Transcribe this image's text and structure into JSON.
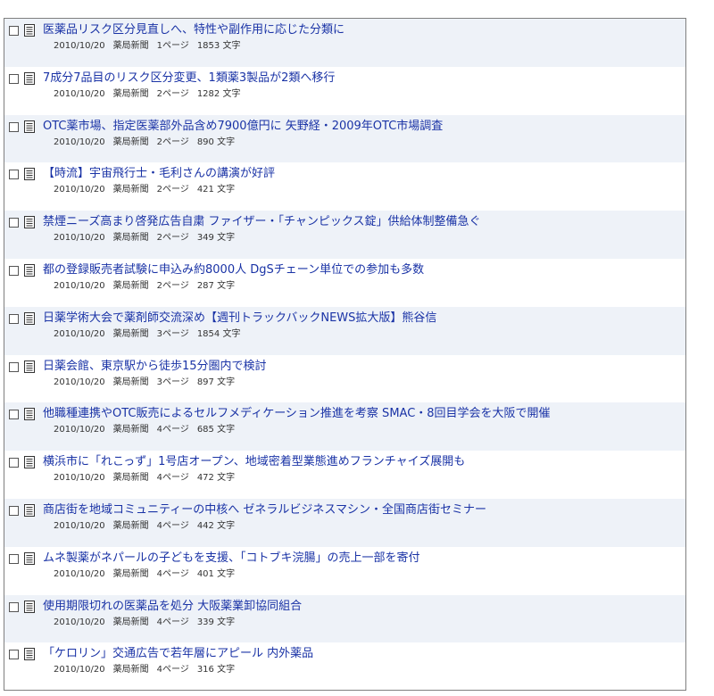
{
  "articles": [
    {
      "title": "医薬品リスク区分見直しへ、特性や副作用に応じた分類に",
      "date": "2010/10/20",
      "source": "薬局新聞",
      "page": "1ページ",
      "chars": "1853 文字"
    },
    {
      "title": "7成分7品目のリスク区分変更、1類薬3製品が2類へ移行",
      "date": "2010/10/20",
      "source": "薬局新聞",
      "page": "2ページ",
      "chars": "1282 文字"
    },
    {
      "title": "OTC薬市場、指定医薬部外品含め7900億円に 矢野経・2009年OTC市場調査",
      "date": "2010/10/20",
      "source": "薬局新聞",
      "page": "2ページ",
      "chars": "890 文字"
    },
    {
      "title": "【時流】宇宙飛行士・毛利さんの講演が好評",
      "date": "2010/10/20",
      "source": "薬局新聞",
      "page": "2ページ",
      "chars": "421 文字"
    },
    {
      "title": "禁煙ニーズ高まり啓発広告自粛 ファイザー・「チャンピックス錠」供給体制整備急ぐ",
      "date": "2010/10/20",
      "source": "薬局新聞",
      "page": "2ページ",
      "chars": "349 文字"
    },
    {
      "title": "都の登録販売者試験に申込み約8000人 DgSチェーン単位での参加も多数",
      "date": "2010/10/20",
      "source": "薬局新聞",
      "page": "2ページ",
      "chars": "287 文字"
    },
    {
      "title": "日薬学術大会で薬剤師交流深め【週刊トラックバックNEWS拡大版】熊谷信",
      "date": "2010/10/20",
      "source": "薬局新聞",
      "page": "3ページ",
      "chars": "1854 文字"
    },
    {
      "title": "日薬会館、東京駅から徒歩15分圏内で検討",
      "date": "2010/10/20",
      "source": "薬局新聞",
      "page": "3ページ",
      "chars": "897 文字"
    },
    {
      "title": "他職種連携やOTC販売によるセルフメディケーション推進を考察 SMAC・8回目学会を大阪で開催",
      "date": "2010/10/20",
      "source": "薬局新聞",
      "page": "4ページ",
      "chars": "685 文字"
    },
    {
      "title": "横浜市に「れこっず」1号店オープン、地域密着型業態進めフランチャイズ展開も",
      "date": "2010/10/20",
      "source": "薬局新聞",
      "page": "4ページ",
      "chars": "472 文字"
    },
    {
      "title": "商店街を地域コミュニティーの中核へ ゼネラルビジネスマシン・全国商店街セミナー",
      "date": "2010/10/20",
      "source": "薬局新聞",
      "page": "4ページ",
      "chars": "442 文字"
    },
    {
      "title": "ムネ製薬がネパールの子どもを支援、「コトブキ浣腸」の売上一部を寄付",
      "date": "2010/10/20",
      "source": "薬局新聞",
      "page": "4ページ",
      "chars": "401 文字"
    },
    {
      "title": "使用期限切れの医薬品を処分 大阪薬業卸協同組合",
      "date": "2010/10/20",
      "source": "薬局新聞",
      "page": "4ページ",
      "chars": "339 文字"
    },
    {
      "title": "「ケロリン」交通広告で若年層にアピール 内外薬品",
      "date": "2010/10/20",
      "source": "薬局新聞",
      "page": "4ページ",
      "chars": "316 文字"
    }
  ],
  "colors": {
    "title_link": "#1a33a6",
    "row_shade": "#eef2f8",
    "border": "#7f7f7f"
  },
  "icons": {
    "checkbox": "checkbox-icon",
    "document": "document-icon"
  }
}
